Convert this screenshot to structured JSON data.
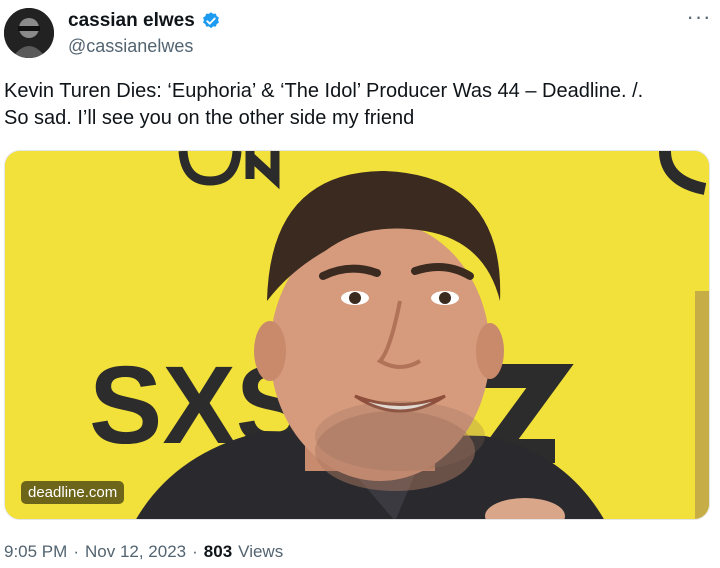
{
  "author": {
    "name": "cassian elwes",
    "handle": "@cassianelwes",
    "verified_color": "#1d9bf0"
  },
  "tweet": {
    "text_line1": "Kevin Turen Dies: ‘Euphoria’ & ‘The Idol’ Producer Was 44 – Deadline. /.",
    "text_line2": "So sad. I’ll see you on the other side my friend"
  },
  "media": {
    "source_badge": "deadline.com",
    "backdrop_text": "SXS",
    "backdrop_color": "#f3e53d"
  },
  "meta": {
    "time": "9:05 PM",
    "separator": "·",
    "date": "Nov 12, 2023",
    "views_count": "803",
    "views_label": "Views"
  },
  "icons": {
    "more": "more-horizontal-icon",
    "verified": "verified-badge-icon"
  }
}
